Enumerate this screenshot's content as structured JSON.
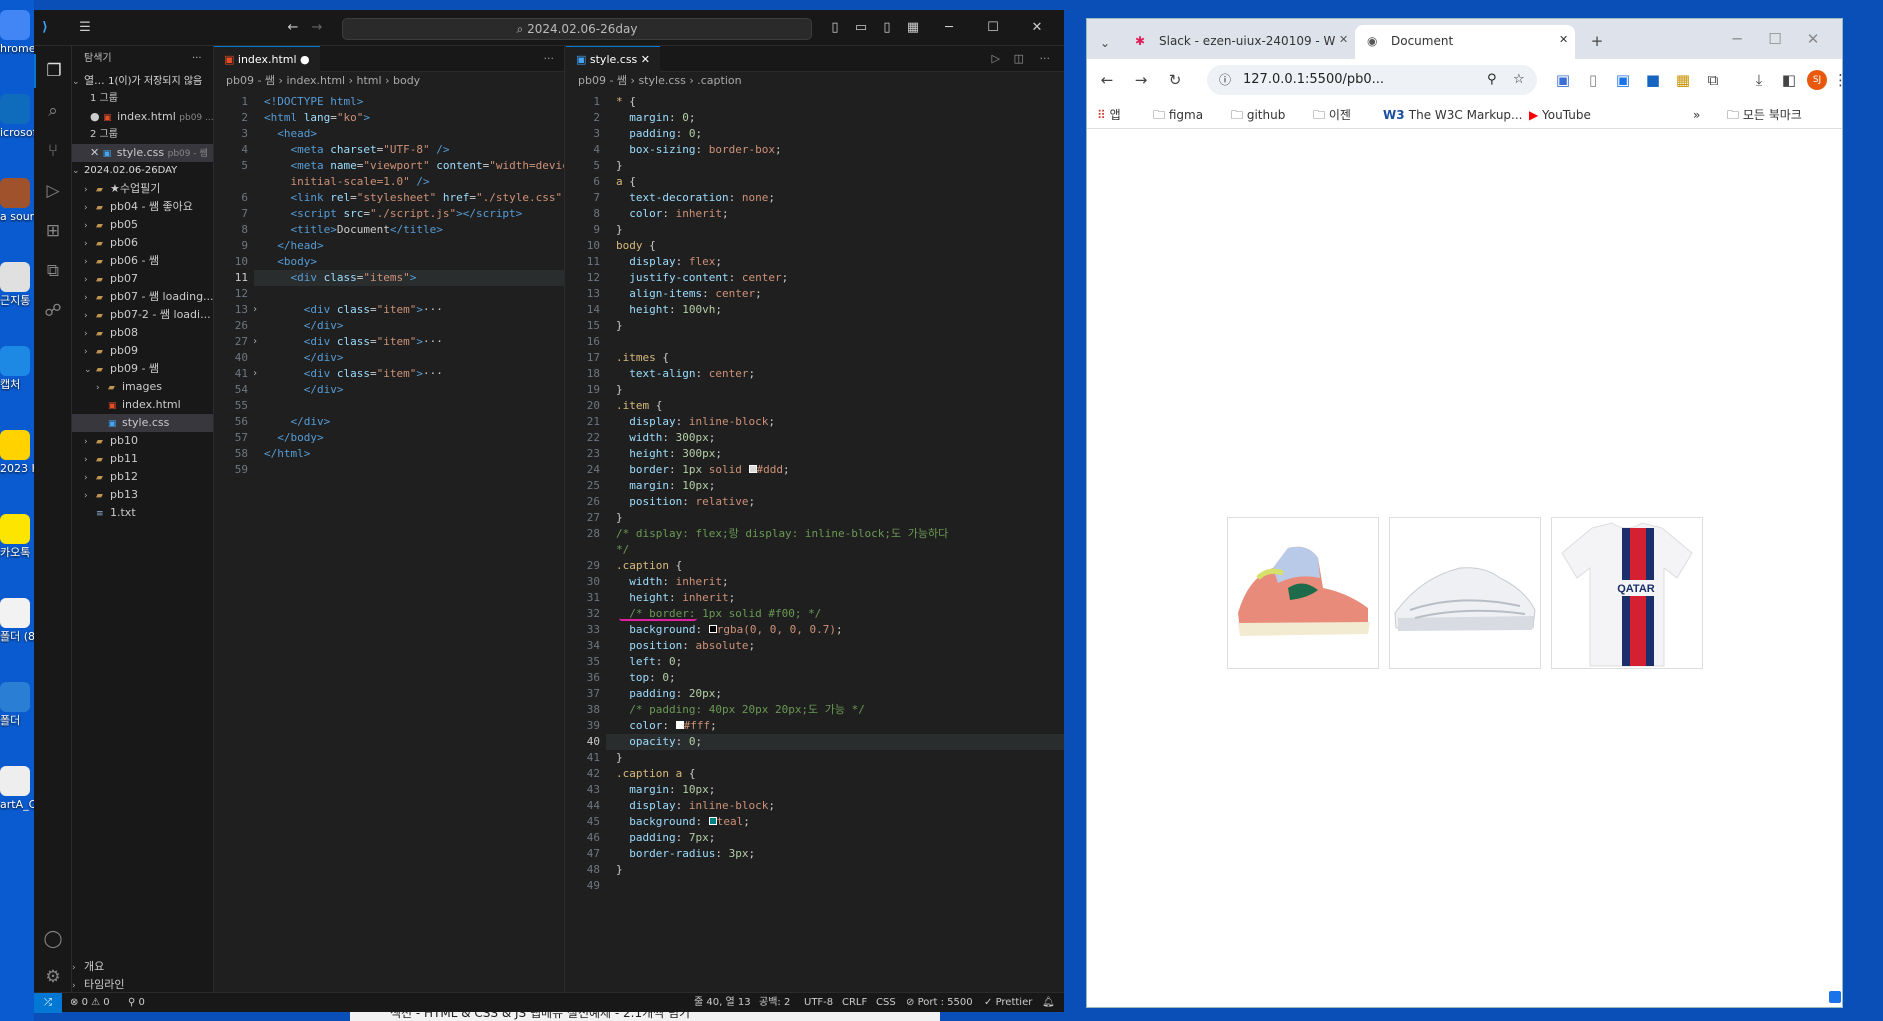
{
  "desktop": {
    "icons": [
      {
        "label": "hrome"
      },
      {
        "label": "icrosof Edge"
      },
      {
        "label": "a sourc Part2"
      },
      {
        "label": "근지통"
      },
      {
        "label": "캡처"
      },
      {
        "label": "2023 K ep교육 사랑P"
      },
      {
        "label": "카오톡"
      },
      {
        "label": "폴더 (8"
      },
      {
        "label": "폴더"
      },
      {
        "label": "artA_C (1)"
      }
    ],
    "bottom_text": "섹션 - HTML & CSS & JS 탭메뉴 실전예제 - 2.1개씩 넘기"
  },
  "vscode": {
    "search": "2024.02.06-26day",
    "sidebar": {
      "title": "탐색기",
      "open_editors": "열...",
      "unsaved": "1(이)가 저장되지 않음",
      "group1": "1 그룹",
      "group1_file": "index.html",
      "group1_path": "pb09 ...",
      "group2": "2 그룹",
      "group2_file": "style.css",
      "group2_path": "pb09 - 쌤",
      "root": "2024.02.06-26DAY",
      "items": [
        {
          "label": "★수업필기",
          "kind": "folder",
          "depth": 1,
          "open": false
        },
        {
          "label": "pb04 - 쌤 좋아요",
          "kind": "folder",
          "depth": 1,
          "open": false
        },
        {
          "label": "pb05",
          "kind": "folder",
          "depth": 1,
          "open": false
        },
        {
          "label": "pb06",
          "kind": "folder",
          "depth": 1,
          "open": false
        },
        {
          "label": "pb06 - 쌤",
          "kind": "folder",
          "depth": 1,
          "open": false
        },
        {
          "label": "pb07",
          "kind": "folder",
          "depth": 1,
          "open": false
        },
        {
          "label": "pb07 - 쌤 loading...",
          "kind": "folder",
          "depth": 1,
          "open": false
        },
        {
          "label": "pb07-2 - 쌤 loadi...",
          "kind": "folder",
          "depth": 1,
          "open": false
        },
        {
          "label": "pb08",
          "kind": "folder",
          "depth": 1,
          "open": false
        },
        {
          "label": "pb09",
          "kind": "folder",
          "depth": 1,
          "open": false
        },
        {
          "label": "pb09 - 쌤",
          "kind": "folder",
          "depth": 1,
          "open": true
        },
        {
          "label": "images",
          "kind": "folder",
          "depth": 2,
          "open": false
        },
        {
          "label": "index.html",
          "kind": "html",
          "depth": 2
        },
        {
          "label": "style.css",
          "kind": "css",
          "depth": 2,
          "selected": true
        },
        {
          "label": "pb10",
          "kind": "folder",
          "depth": 1,
          "open": false
        },
        {
          "label": "pb11",
          "kind": "folder",
          "depth": 1,
          "open": false
        },
        {
          "label": "pb12",
          "kind": "folder",
          "depth": 1,
          "open": false
        },
        {
          "label": "pb13",
          "kind": "folder",
          "depth": 1,
          "open": false
        },
        {
          "label": "1.txt",
          "kind": "txt",
          "depth": 1
        }
      ],
      "outline": "개요",
      "timeline": "타임라인"
    },
    "left_editor": {
      "tab": "index.html",
      "crumbs": [
        "pb09 - 쌤",
        "index.html",
        "html",
        "body"
      ],
      "lines": [
        {
          "n": "1",
          "html": "<span class='t'>&lt;!DOCTYPE html&gt;</span>"
        },
        {
          "n": "2",
          "html": "<span class='t'>&lt;html</span> <span class='a'>lang</span>=<span class='s'>\"ko\"</span><span class='t'>&gt;</span>"
        },
        {
          "n": "3",
          "html": "  <span class='t'>&lt;head&gt;</span>"
        },
        {
          "n": "4",
          "html": "    <span class='t'>&lt;meta</span> <span class='a'>charset</span>=<span class='s'>\"UTF-8\"</span> <span class='t'>/&gt;</span>"
        },
        {
          "n": "5",
          "html": "    <span class='t'>&lt;meta</span> <span class='a'>name</span>=<span class='s'>\"viewport\"</span> <span class='a'>content</span>=<span class='s'>\"width=device-width,</span>"
        },
        {
          "n": "",
          "html": "    <span class='s'>initial-scale=1.0\"</span> <span class='t'>/&gt;</span>"
        },
        {
          "n": "6",
          "html": "    <span class='t'>&lt;link</span> <span class='a'>rel</span>=<span class='s'>\"stylesheet\"</span> <span class='a'>href</span>=<span class='s'>\"./style.css\"</span> <span class='t'>/&gt;</span>"
        },
        {
          "n": "7",
          "html": "    <span class='t'>&lt;script</span> <span class='a'>src</span>=<span class='s'>\"./script.js\"</span><span class='t'>&gt;&lt;/script&gt;</span>"
        },
        {
          "n": "8",
          "html": "    <span class='t'>&lt;title&gt;</span>Document<span class='t'>&lt;/title&gt;</span>"
        },
        {
          "n": "9",
          "html": "  <span class='t'>&lt;/head&gt;</span>"
        },
        {
          "n": "10",
          "html": "  <span class='t'>&lt;body&gt;</span>"
        },
        {
          "n": "11",
          "html": "    <span class='t'>&lt;div</span> <span class='a'>class</span>=<span class='s'>\"items\"</span><span class='t'>&gt;</span>",
          "cur": true
        },
        {
          "n": "12",
          "html": ""
        },
        {
          "n": "13",
          "html": "      <span class='t'>&lt;div</span> <span class='a'>class</span>=<span class='s'>\"item\"</span><span class='t'>&gt;</span>···",
          "fold": true
        },
        {
          "n": "26",
          "html": "      <span class='t'>&lt;/div&gt;</span>"
        },
        {
          "n": "27",
          "html": "      <span class='t'>&lt;div</span> <span class='a'>class</span>=<span class='s'>\"item\"</span><span class='t'>&gt;</span>···",
          "fold": true
        },
        {
          "n": "40",
          "html": "      <span class='t'>&lt;/div&gt;</span>"
        },
        {
          "n": "41",
          "html": "      <span class='t'>&lt;div</span> <span class='a'>class</span>=<span class='s'>\"item\"</span><span class='t'>&gt;</span>···",
          "fold": true
        },
        {
          "n": "54",
          "html": "      <span class='t'>&lt;/div&gt;</span>"
        },
        {
          "n": "55",
          "html": ""
        },
        {
          "n": "56",
          "html": "    <span class='t'>&lt;/div&gt;</span>"
        },
        {
          "n": "57",
          "html": "  <span class='t'>&lt;/body&gt;</span>"
        },
        {
          "n": "58",
          "html": "<span class='t'>&lt;/html&gt;</span>"
        },
        {
          "n": "59",
          "html": ""
        }
      ]
    },
    "right_editor": {
      "tab": "style.css",
      "crumbs": [
        "pb09 - 쌤",
        "style.css",
        ".caption"
      ],
      "lines": [
        {
          "n": "1",
          "html": "<span class='sel2'>*</span> {"
        },
        {
          "n": "2",
          "html": "  <span class='p'>margin</span>: <span class='n'>0</span>;"
        },
        {
          "n": "3",
          "html": "  <span class='p'>padding</span>: <span class='n'>0</span>;"
        },
        {
          "n": "4",
          "html": "  <span class='p'>box-sizing</span>: <span class='v'>border-box</span>;"
        },
        {
          "n": "5",
          "html": "}"
        },
        {
          "n": "6",
          "html": "<span class='sel2'>a</span> {"
        },
        {
          "n": "7",
          "html": "  <span class='p'>text-decoration</span>: <span class='v'>none</span>;"
        },
        {
          "n": "8",
          "html": "  <span class='p'>color</span>: <span class='v'>inherit</span>;"
        },
        {
          "n": "9",
          "html": "}"
        },
        {
          "n": "10",
          "html": "<span class='sel2'>body</span> {"
        },
        {
          "n": "11",
          "html": "  <span class='p'>display</span>: <span class='v'>flex</span>;"
        },
        {
          "n": "12",
          "html": "  <span class='p'>justify-content</span>: <span class='v'>center</span>;"
        },
        {
          "n": "13",
          "html": "  <span class='p'>align-items</span>: <span class='v'>center</span>;"
        },
        {
          "n": "14",
          "html": "  <span class='p'>height</span>: <span class='n'>100vh</span>;"
        },
        {
          "n": "15",
          "html": "}"
        },
        {
          "n": "16",
          "html": ""
        },
        {
          "n": "17",
          "html": "<span class='sel2'>.itmes</span> {"
        },
        {
          "n": "18",
          "html": "  <span class='p'>text-align</span>: <span class='v'>center</span>;"
        },
        {
          "n": "19",
          "html": "}"
        },
        {
          "n": "20",
          "html": "<span class='sel2'>.item</span> {"
        },
        {
          "n": "21",
          "html": "  <span class='p'>display</span>: <span class='v'>inline-block</span>;"
        },
        {
          "n": "22",
          "html": "  <span class='p'>width</span>: <span class='n'>300px</span>;"
        },
        {
          "n": "23",
          "html": "  <span class='p'>height</span>: <span class='n'>300px</span>;"
        },
        {
          "n": "24",
          "html": "  <span class='p'>border</span>: <span class='n'>1px</span> <span class='v'>solid</span> <span style='display:inline-block;width:8px;height:8px;background:#ddd;border:1px solid #fff'></span><span class='v'>#ddd</span>;"
        },
        {
          "n": "25",
          "html": "  <span class='p'>margin</span>: <span class='n'>10px</span>;"
        },
        {
          "n": "26",
          "html": "  <span class='p'>position</span>: <span class='v'>relative</span>;"
        },
        {
          "n": "27",
          "html": "}"
        },
        {
          "n": "28",
          "html": "<span class='c'>/* display: flex;랑 display: inline-block;도 가능하다</span>"
        },
        {
          "n": "",
          "html": "<span class='c'>*/</span>"
        },
        {
          "n": "29",
          "html": "<span class='sel2'>.caption</span> {"
        },
        {
          "n": "30",
          "html": "  <span class='p'>width</span>: <span class='v'>inherit</span>;"
        },
        {
          "n": "31",
          "html": "  <span class='p'>height</span>: <span class='v'>inherit</span>;"
        },
        {
          "n": "32",
          "html": "  <span class='c'>/* border: 1px solid #f00; */</span>"
        },
        {
          "n": "33",
          "html": "  <span class='p'>background</span>: <span style='display:inline-block;width:8px;height:8px;background:#000;border:1px solid #fff'></span><span class='v'>rgba(0, 0, 0, 0.7)</span>;"
        },
        {
          "n": "34",
          "html": "  <span class='p'>position</span>: <span class='v'>absolute</span>;"
        },
        {
          "n": "35",
          "html": "  <span class='p'>left</span>: <span class='n'>0</span>;"
        },
        {
          "n": "36",
          "html": "  <span class='p'>top</span>: <span class='n'>0</span>;"
        },
        {
          "n": "37",
          "html": "  <span class='p'>padding</span>: <span class='n'>20px</span>;"
        },
        {
          "n": "38",
          "html": "  <span class='c'>/* padding: 40px 20px 20px;도 가능 */</span>"
        },
        {
          "n": "39",
          "html": "  <span class='p'>color</span>: <span style='display:inline-block;width:8px;height:8px;background:#fff'></span><span class='v'>#fff</span>;"
        },
        {
          "n": "40",
          "html": "  <span class='p'>opacity</span>: <span class='n'>0</span>;",
          "cur": true
        },
        {
          "n": "41",
          "html": "}"
        },
        {
          "n": "42",
          "html": "<span class='sel2'>.caption a</span> {"
        },
        {
          "n": "43",
          "html": "  <span class='p'>margin</span>: <span class='n'>10px</span>;"
        },
        {
          "n": "44",
          "html": "  <span class='p'>display</span>: <span class='v'>inline-block</span>;"
        },
        {
          "n": "45",
          "html": "  <span class='p'>background</span>: <span style='display:inline-block;width:8px;height:8px;background:teal;border:1px solid #fff'></span><span class='v'>teal</span>;"
        },
        {
          "n": "46",
          "html": "  <span class='p'>padding</span>: <span class='n'>7px</span>;"
        },
        {
          "n": "47",
          "html": "  <span class='p'>border-radius</span>: <span class='n'>3px</span>;"
        },
        {
          "n": "48",
          "html": "}"
        },
        {
          "n": "49",
          "html": ""
        }
      ]
    },
    "status": {
      "errors": "0",
      "warnings": "0",
      "ports": "0",
      "position": "줄 40, 열 13",
      "spaces": "공백: 2",
      "encoding": "UTF-8",
      "eol": "CRLF",
      "lang": "CSS",
      "port": "Port : 5500",
      "prettier": "Prettier"
    }
  },
  "browser": {
    "tabs": [
      {
        "label": "Slack - ezen-uiux-240109 - W"
      },
      {
        "label": "Document"
      }
    ],
    "url": "127.0.0.1:5500/pb0...",
    "avatar": "SJ",
    "bookmarks": [
      {
        "label": "앱"
      },
      {
        "label": "figma"
      },
      {
        "label": "github"
      },
      {
        "label": "이젠"
      },
      {
        "label": "The W3C Markup..."
      },
      {
        "label": "YouTube"
      },
      {
        "label": "모든 북마크"
      }
    ],
    "items": [
      {
        "name": "sneaker-pastel"
      },
      {
        "name": "sneaker-white"
      },
      {
        "name": "psg-jersey"
      }
    ]
  }
}
